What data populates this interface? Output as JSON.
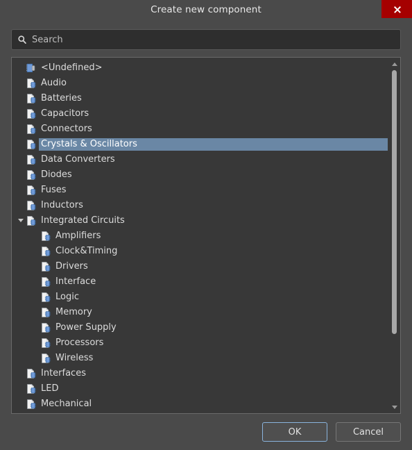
{
  "window": {
    "title": "Create new component",
    "close_label": "×",
    "close_icon": "close-icon"
  },
  "search": {
    "placeholder": "Search",
    "value": "",
    "icon": "search-icon"
  },
  "tree": {
    "icon_default": "component-file-icon",
    "icon_undefined": "undefined-component-icon",
    "selected": "Crystals & Oscillators",
    "items": [
      {
        "label": "<Undefined>",
        "level": 0,
        "icon": "undefined-component-icon",
        "expandable": false,
        "selected": false
      },
      {
        "label": "Audio",
        "level": 0,
        "icon": "component-file-icon",
        "expandable": false,
        "selected": false
      },
      {
        "label": "Batteries",
        "level": 0,
        "icon": "component-file-icon",
        "expandable": false,
        "selected": false
      },
      {
        "label": "Capacitors",
        "level": 0,
        "icon": "component-file-icon",
        "expandable": false,
        "selected": false
      },
      {
        "label": "Connectors",
        "level": 0,
        "icon": "component-file-icon",
        "expandable": false,
        "selected": false
      },
      {
        "label": "Crystals & Oscillators",
        "level": 0,
        "icon": "component-file-icon",
        "expandable": false,
        "selected": true
      },
      {
        "label": "Data Converters",
        "level": 0,
        "icon": "component-file-icon",
        "expandable": false,
        "selected": false
      },
      {
        "label": "Diodes",
        "level": 0,
        "icon": "component-file-icon",
        "expandable": false,
        "selected": false
      },
      {
        "label": "Fuses",
        "level": 0,
        "icon": "component-file-icon",
        "expandable": false,
        "selected": false
      },
      {
        "label": "Inductors",
        "level": 0,
        "icon": "component-file-icon",
        "expandable": false,
        "selected": false
      },
      {
        "label": "Integrated Circuits",
        "level": 0,
        "icon": "component-file-icon",
        "expandable": true,
        "expanded": true,
        "selected": false
      },
      {
        "label": "Amplifiers",
        "level": 1,
        "icon": "component-file-icon",
        "expandable": false,
        "selected": false
      },
      {
        "label": "Clock&Timing",
        "level": 1,
        "icon": "component-file-icon",
        "expandable": false,
        "selected": false
      },
      {
        "label": "Drivers",
        "level": 1,
        "icon": "component-file-icon",
        "expandable": false,
        "selected": false
      },
      {
        "label": "Interface",
        "level": 1,
        "icon": "component-file-icon",
        "expandable": false,
        "selected": false
      },
      {
        "label": "Logic",
        "level": 1,
        "icon": "component-file-icon",
        "expandable": false,
        "selected": false
      },
      {
        "label": "Memory",
        "level": 1,
        "icon": "component-file-icon",
        "expandable": false,
        "selected": false
      },
      {
        "label": "Power Supply",
        "level": 1,
        "icon": "component-file-icon",
        "expandable": false,
        "selected": false
      },
      {
        "label": "Processors",
        "level": 1,
        "icon": "component-file-icon",
        "expandable": false,
        "selected": false
      },
      {
        "label": "Wireless",
        "level": 1,
        "icon": "component-file-icon",
        "expandable": false,
        "selected": false
      },
      {
        "label": "Interfaces",
        "level": 0,
        "icon": "component-file-icon",
        "expandable": false,
        "selected": false
      },
      {
        "label": "LED",
        "level": 0,
        "icon": "component-file-icon",
        "expandable": false,
        "selected": false
      },
      {
        "label": "Mechanical",
        "level": 0,
        "icon": "component-file-icon",
        "expandable": false,
        "selected": false
      }
    ]
  },
  "scrollbar": {
    "up_icon": "scroll-up-arrow-icon",
    "down_icon": "scroll-down-arrow-icon"
  },
  "footer": {
    "ok_label": "OK",
    "cancel_label": "Cancel"
  },
  "colors": {
    "dialog_background": "#4a4a4a",
    "panel_background": "#383838",
    "selection": "#6a87a5",
    "close_button": "#a50000",
    "primary_border": "#8ab4dd",
    "icon_blue": "#6f9ad8"
  }
}
